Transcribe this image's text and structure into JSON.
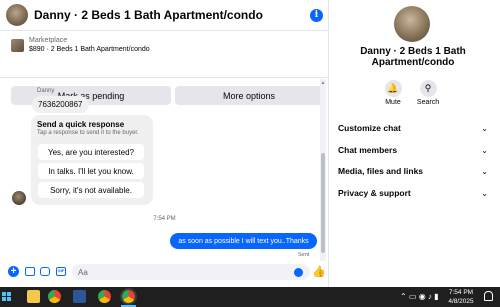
{
  "header": {
    "title": "Danny · 2 Beds 1 Bath Apartment/condo",
    "info_icon": "i"
  },
  "marketplace": {
    "label": "Marketplace",
    "listing": "$890 · 2 Beds 1 Bath Apartment/condo",
    "buttons": {
      "pending": "Mark as pending",
      "more": "More options"
    }
  },
  "messages": {
    "sender_name": "Danny",
    "incoming_text": "7636200867",
    "quick_response": {
      "title": "Send a quick response",
      "subtitle": "Tap a response to send it to the buyer.",
      "options": [
        "Yes, are you interested?",
        "In talks. I'll let you know.",
        "Sorry, it's not available."
      ]
    },
    "time_divider": "7:54 PM",
    "outgoing_text": "as soon as possible I will text you..Thanks",
    "sent_label": "Sent"
  },
  "composer": {
    "placeholder": "Aa"
  },
  "info_panel": {
    "name": "Danny · 2 Beds 1 Bath Apartment/condo",
    "actions": {
      "mute": "Mute",
      "search": "Search"
    },
    "rows": [
      "Customize chat",
      "Chat members",
      "Media, files and links",
      "Privacy & support"
    ]
  },
  "taskbar": {
    "time": "7:54 PM",
    "date": "4/8/2025"
  },
  "colors": {
    "accent": "#0866ff",
    "bubble_gray": "#f0f0f0",
    "button_gray": "#e4e6eb",
    "taskbar": "#1f1f1f"
  }
}
